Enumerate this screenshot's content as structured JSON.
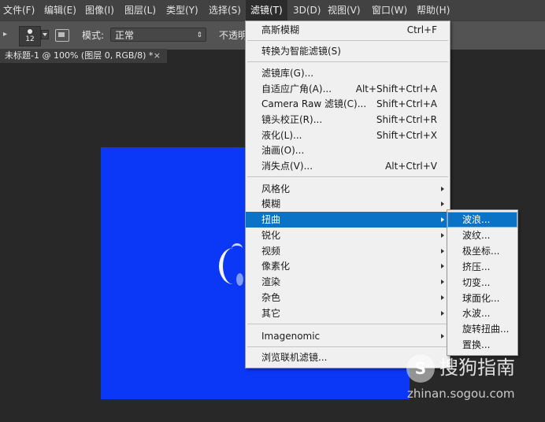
{
  "menubar": {
    "items": [
      "文件(F)",
      "编辑(E)",
      "图像(I)",
      "图层(L)",
      "类型(Y)",
      "选择(S)",
      "滤镜(T)",
      "3D(D)",
      "视图(V)",
      "窗口(W)",
      "帮助(H)"
    ],
    "active": "滤镜(T)"
  },
  "options_bar": {
    "brush_size": "12",
    "mode_label": "模式:",
    "mode_value": "正常",
    "opacity_label": "不透明"
  },
  "document_tab": {
    "title": "未标题-1 @ 100% (图层 0, RGB/8) *",
    "close": "×"
  },
  "canvas": {
    "fill_color": "#0b37f6"
  },
  "filter_menu": {
    "items": [
      {
        "label": "高斯模糊",
        "shortcut": "Ctrl+F"
      },
      {
        "label": "转换为智能滤镜(S)"
      },
      {
        "label": "滤镜库(G)..."
      },
      {
        "label": "自适应广角(A)...",
        "shortcut": "Alt+Shift+Ctrl+A"
      },
      {
        "label": "Camera Raw 滤镜(C)...",
        "shortcut": "Shift+Ctrl+A"
      },
      {
        "label": "镜头校正(R)...",
        "shortcut": "Shift+Ctrl+R"
      },
      {
        "label": "液化(L)...",
        "shortcut": "Shift+Ctrl+X"
      },
      {
        "label": "油画(O)..."
      },
      {
        "label": "消失点(V)...",
        "shortcut": "Alt+Ctrl+V"
      },
      {
        "label": "风格化",
        "submenu": true
      },
      {
        "label": "模糊",
        "submenu": true
      },
      {
        "label": "扭曲",
        "submenu": true,
        "highlighted": true
      },
      {
        "label": "锐化",
        "submenu": true
      },
      {
        "label": "视频",
        "submenu": true
      },
      {
        "label": "像素化",
        "submenu": true
      },
      {
        "label": "渲染",
        "submenu": true
      },
      {
        "label": "杂色",
        "submenu": true
      },
      {
        "label": "其它",
        "submenu": true
      },
      {
        "label": "Imagenomic",
        "submenu": true
      },
      {
        "label": "浏览联机滤镜..."
      }
    ]
  },
  "distort_submenu": {
    "items": [
      "波浪...",
      "波纹...",
      "极坐标...",
      "挤压...",
      "切变...",
      "球面化...",
      "水波...",
      "旋转扭曲...",
      "置换..."
    ],
    "highlighted": "波浪..."
  },
  "watermark": {
    "logo_glyph": "S",
    "name": "搜狗指南",
    "url": "zhinan.sogou.com"
  },
  "colors": {
    "menu_highlight": "#0a73c6",
    "canvas_blue": "#0b37f6",
    "menubar_bg": "#424242",
    "workspace_bg": "#282828"
  }
}
